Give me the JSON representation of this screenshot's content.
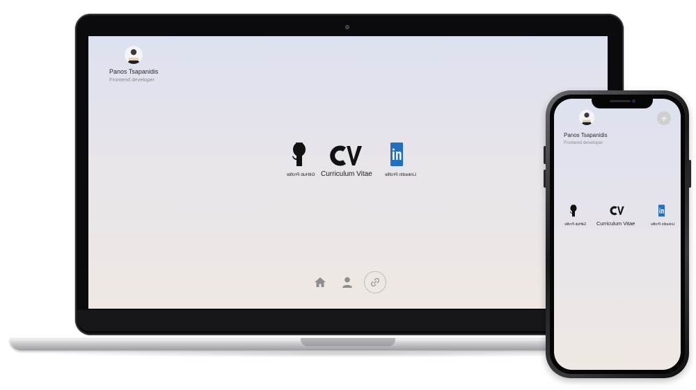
{
  "laptop": {
    "profile": {
      "name": "Panos Tsapanidis",
      "role": "Frontend developer"
    },
    "links": [
      {
        "icon": "github-icon",
        "label": "GitHub Profile"
      },
      {
        "icon": "cv-icon",
        "logo_text": "CV",
        "label": "Curriculum Vitae"
      },
      {
        "icon": "linkedin-icon",
        "label": "LinkedIn Profile"
      }
    ],
    "nav": [
      {
        "icon": "home-icon",
        "active": false
      },
      {
        "icon": "user-icon",
        "active": false
      },
      {
        "icon": "link-icon",
        "active": true
      }
    ]
  },
  "phone": {
    "profile": {
      "name": "Panos Tsapanidis",
      "role": "Frontend developer"
    },
    "plus_button": "+",
    "links": [
      {
        "icon": "github-icon",
        "label": "GitHub Profile"
      },
      {
        "icon": "cv-icon",
        "logo_text": "CV",
        "label": "Curriculum Vitae"
      },
      {
        "icon": "linkedin-icon",
        "label": "LinkedIn Profile"
      }
    ]
  },
  "colors": {
    "gradient_top": "#dde1ef",
    "gradient_bottom": "#efe8e3",
    "linkedin_blue": "#1f6fc5",
    "frame": "#0b0b0d"
  }
}
